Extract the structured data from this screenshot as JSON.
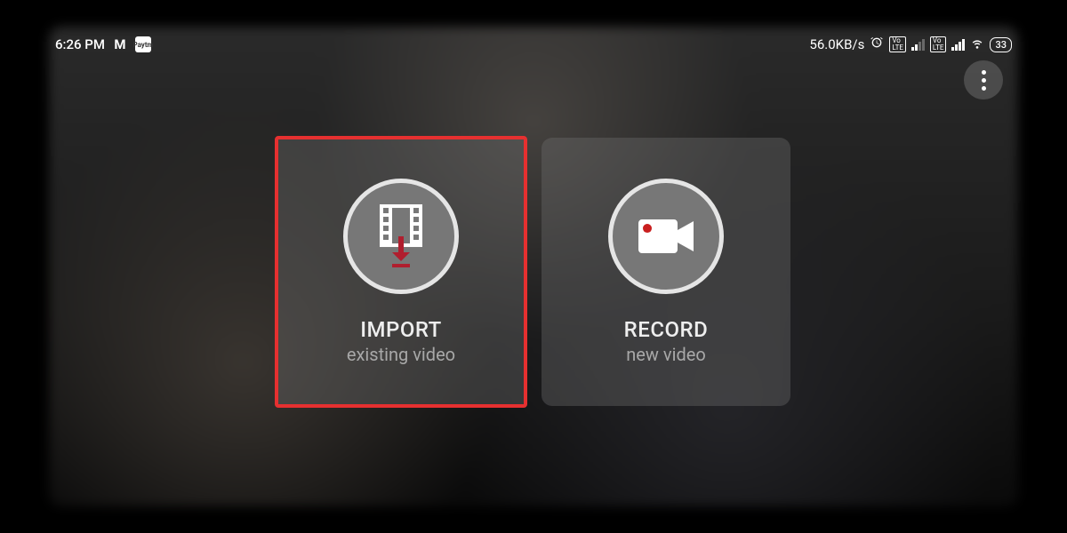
{
  "status_bar": {
    "time": "6:26 PM",
    "app_icon_1": "M",
    "app_icon_2": "Paytm",
    "network_speed": "56.0KB/s",
    "battery_level": "33"
  },
  "more_button": {
    "label": "More options"
  },
  "cards": {
    "import": {
      "title": "IMPORT",
      "subtitle": "existing video"
    },
    "record": {
      "title": "RECORD",
      "subtitle": "new video"
    }
  },
  "highlighted_card": "import"
}
